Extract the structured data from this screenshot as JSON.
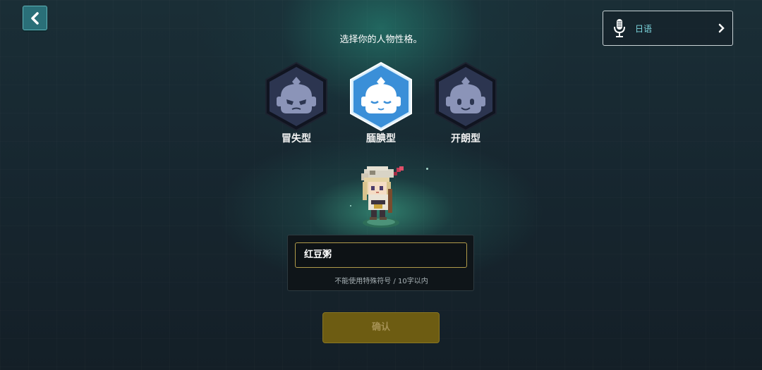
{
  "prompt": "选择你的人物性格。",
  "language": {
    "label": "日语",
    "icon": "microphone-icon"
  },
  "personalities": [
    {
      "label": "冒失型",
      "selected": false,
      "face": "angry"
    },
    {
      "label": "腼腆型",
      "selected": true,
      "face": "shy"
    },
    {
      "label": "开朗型",
      "selected": false,
      "face": "happy"
    }
  ],
  "name_input": {
    "value": "红豆粥"
  },
  "hint": "不能使用特殊符号 / 10字以内",
  "confirm_label": "确认",
  "colors": {
    "selected_hex": "#3a8fd8",
    "unselected_hex": "#2c3550",
    "icon_light": "#8b94b8",
    "confirm_bg": "#6d5c12",
    "lang_text": "#7ed8e0"
  }
}
